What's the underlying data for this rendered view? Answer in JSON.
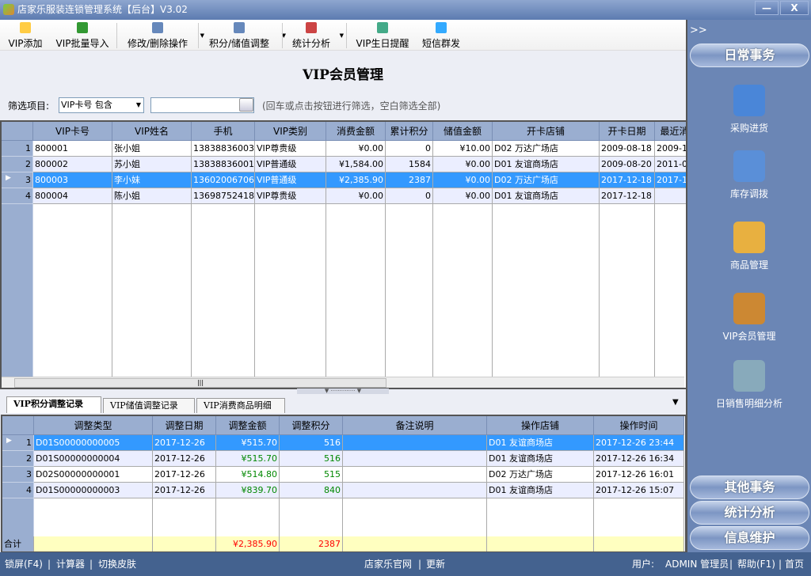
{
  "window": {
    "title": "店家乐服装连锁管理系统【后台】V3.02",
    "minimize": "—",
    "close": "X"
  },
  "toolbar": [
    {
      "label": "VIP添加",
      "icon": "add-icon",
      "dropdown": false
    },
    {
      "label": "VIP批量导入",
      "icon": "excel-icon",
      "dropdown": false
    },
    {
      "label": "修改/删除操作",
      "icon": "edit-icon",
      "dropdown": true
    },
    {
      "label": "积分/储值调整",
      "icon": "edit-icon",
      "dropdown": true
    },
    {
      "label": "统计分析",
      "icon": "chart-icon",
      "dropdown": true
    },
    {
      "label": "VIP生日提醒",
      "icon": "gift-icon",
      "dropdown": false
    },
    {
      "label": "短信群发",
      "icon": "phone-icon",
      "dropdown": false
    }
  ],
  "page_title": "VIP会员管理",
  "filter": {
    "label": "筛选项目:",
    "select_value": "VIP卡号 包含",
    "input_value": "",
    "hint": "(回车或点击按钮进行筛选，空白筛选全部)"
  },
  "vip_grid": {
    "columns": [
      "VIP卡号",
      "VIP姓名",
      "手机",
      "VIP类别",
      "消费金额",
      "累计积分",
      "储值金额",
      "开卡店铺",
      "开卡日期",
      "最近消"
    ],
    "rows": [
      {
        "n": "1",
        "cells": [
          "800001",
          "张小姐",
          "13838836003",
          "VIP尊贵级",
          "¥0.00",
          "0",
          "¥10.00",
          "D02 万达广场店",
          "2009-08-18",
          "2009-10"
        ]
      },
      {
        "n": "2",
        "cells": [
          "800002",
          "苏小姐",
          "13838836001",
          "VIP普通级",
          "¥1,584.00",
          "1584",
          "¥0.00",
          "D01 友谊商场店",
          "2009-08-20",
          "2011-05"
        ]
      },
      {
        "n": "3",
        "cells": [
          "800003",
          "李小妹",
          "13602006706",
          "VIP普通级",
          "¥2,385.90",
          "2387",
          "¥0.00",
          "D02 万达广场店",
          "2017-12-18",
          "2017-12"
        ]
      },
      {
        "n": "4",
        "cells": [
          "800004",
          "陈小姐",
          "13698752418",
          "VIP尊贵级",
          "¥0.00",
          "0",
          "¥0.00",
          "D01 友谊商场店",
          "2017-12-18",
          ""
        ]
      }
    ],
    "selected_row": 3
  },
  "tabs": [
    "VIP积分调整记录",
    "VIP储值调整记录",
    "VIP消费商品明细"
  ],
  "active_tab": 0,
  "adjust_grid": {
    "columns": [
      "调整类型",
      "调整日期",
      "调整金额",
      "调整积分",
      "备注说明",
      "操作店铺",
      "操作时间"
    ],
    "rows": [
      {
        "n": "1",
        "cells": [
          "D01S00000000005",
          "2017-12-26",
          "¥515.70",
          "516",
          "",
          "D01 友谊商场店",
          "2017-12-26 23:44"
        ]
      },
      {
        "n": "2",
        "cells": [
          "D01S00000000004",
          "2017-12-26",
          "¥515.70",
          "516",
          "",
          "D01 友谊商场店",
          "2017-12-26 16:34"
        ]
      },
      {
        "n": "3",
        "cells": [
          "D02S00000000001",
          "2017-12-26",
          "¥514.80",
          "515",
          "",
          "D02 万达广场店",
          "2017-12-26 16:01"
        ]
      },
      {
        "n": "4",
        "cells": [
          "D01S00000000003",
          "2017-12-26",
          "¥839.70",
          "840",
          "",
          "D01 友谊商场店",
          "2017-12-26 15:07"
        ]
      }
    ],
    "selected_row": 1,
    "total_label": "合计",
    "total_amount": "¥2,385.90",
    "total_points": "2387"
  },
  "sidebar": {
    "toggle": ">>",
    "daily": "日常事务",
    "items": [
      {
        "label": "采购进货",
        "icon": "purchase-house-icon"
      },
      {
        "label": "库存调拨",
        "icon": "transfer-house-icon"
      },
      {
        "label": "商品管理",
        "icon": "goods-box-icon"
      },
      {
        "label": "VIP会员管理",
        "icon": "vip-icon"
      },
      {
        "label": "日销售明细分析",
        "icon": "analysis-icon"
      }
    ],
    "bottom": [
      "其他事务",
      "统计分析",
      "信息维护"
    ]
  },
  "statusbar": {
    "lock": "锁屏(F4)",
    "sep": "|",
    "calc": "计算器",
    "skin": "切换皮肤",
    "site": "店家乐官网",
    "update": "更新",
    "user_label": "用户:",
    "user": "ADMIN 管理员",
    "help": "帮助(F1)",
    "home": "首页"
  },
  "colors": {
    "selected": "#3399ff",
    "header": "#9aaed0",
    "sidebar": "#6b86b5",
    "statusbar": "#44628f",
    "total_bg": "#ffffc0",
    "total_text": "#ff0000"
  }
}
